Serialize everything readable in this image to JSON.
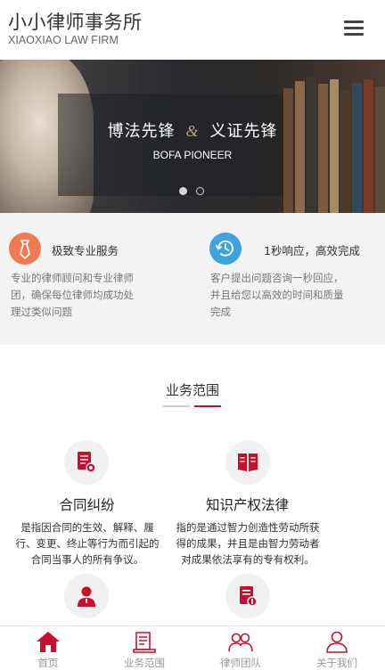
{
  "header": {
    "brand_cn": "小小律师事务所",
    "brand_en": "XIAOXIAO LAW FIRM",
    "menu_icon": "hamburger-menu-icon"
  },
  "banner": {
    "title_left": "博法先锋",
    "title_amp": "&",
    "title_right": "义证先锋",
    "subtitle": "BOFA PIONEER",
    "slide_count": 2,
    "active_slide": 1
  },
  "features": [
    {
      "icon": "necktie-icon",
      "color": "#f07a52",
      "title": "极致专业服务",
      "desc_lines": [
        "专业的律师顾问和专业律师",
        "团，确保每位律师均成功处",
        "理过类似问题"
      ]
    },
    {
      "icon": "clock-refresh-icon",
      "color": "#3fa3de",
      "title": "1秒响应，高效完成",
      "desc_lines": [
        "客户提出问题咨询一秒回应，",
        "并且给您以高效的时间和质量",
        "完成"
      ]
    }
  ],
  "section": {
    "title": "业务范围"
  },
  "services": [
    {
      "icon": "contract-document-icon",
      "title": "合同纠纷",
      "desc_lines": [
        "是指因合同的生效、解释、履",
        "行、变更、终止等行为而引起的",
        "合同当事人的所有争议。"
      ]
    },
    {
      "icon": "open-book-icon",
      "title": "知识产权法律",
      "desc_lines": [
        "指的是通过智力创造性劳动所获",
        "得的成果，并且是由智力劳动者",
        "对成果依法享有的专有权利。"
      ]
    },
    {
      "icon": "lawyer-person-icon",
      "title": "",
      "desc_lines": []
    },
    {
      "icon": "bill-document-icon",
      "title": "",
      "desc_lines": []
    }
  ],
  "nav": [
    {
      "icon": "home-icon",
      "label": "首页",
      "active": true
    },
    {
      "icon": "business-scope-icon",
      "label": "业务范围",
      "active": false
    },
    {
      "icon": "team-icon",
      "label": "律师团队",
      "active": false
    },
    {
      "icon": "user-icon",
      "label": "关于我们",
      "active": false
    }
  ],
  "colors": {
    "accent": "#c8102e",
    "text": "#333333",
    "muted": "#777777",
    "feature_bg": "#f3f3f3"
  }
}
